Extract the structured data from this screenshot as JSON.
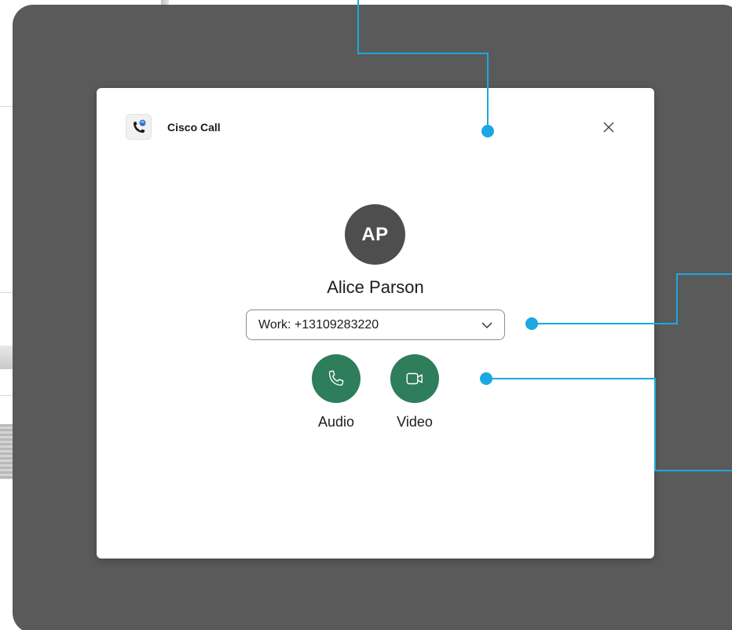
{
  "dialog": {
    "app_title": "Cisco Call",
    "app_icon": "phone-icon",
    "close_icon": "close-icon"
  },
  "contact": {
    "initials": "AP",
    "name": "Alice Parson"
  },
  "number_select": {
    "selected": "Work: +13109283220",
    "icon": "chevron-down-icon"
  },
  "actions": {
    "audio_label": "Audio",
    "audio_icon": "phone-icon",
    "video_label": "Video",
    "video_icon": "video-camera-icon"
  },
  "colors": {
    "call_button": "#2e7d5b",
    "avatar": "#4e4e4e",
    "callout_line": "#19a9e0",
    "backdrop": "#5a5a5a"
  }
}
